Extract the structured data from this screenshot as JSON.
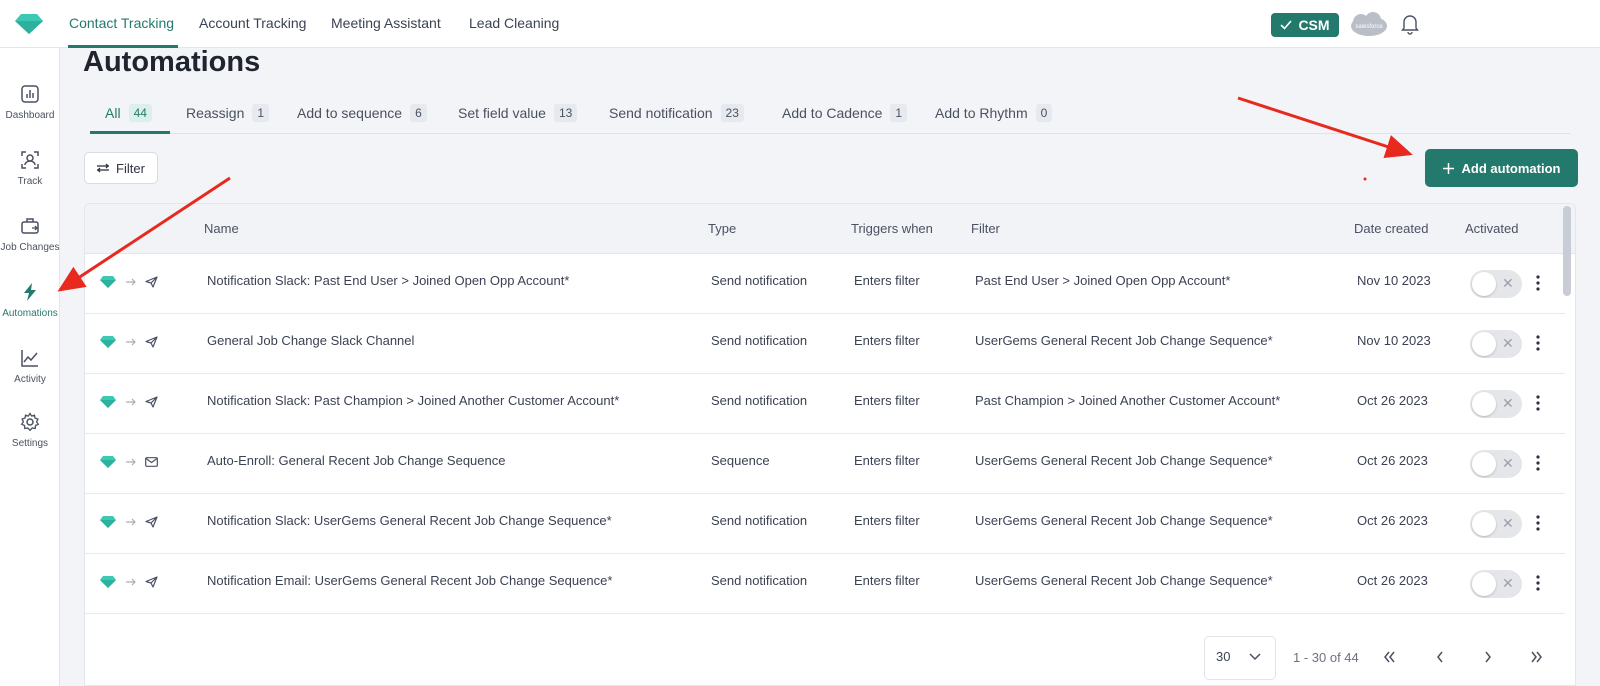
{
  "topnav": {
    "items": [
      {
        "label": "Contact Tracking",
        "active": true
      },
      {
        "label": "Account Tracking",
        "active": false
      },
      {
        "label": "Meeting Assistant",
        "active": false
      },
      {
        "label": "Lead Cleaning",
        "active": false
      }
    ],
    "csm_label": "CSM",
    "salesforce_label": "salesforce"
  },
  "sidebar": {
    "items": [
      {
        "label": "Dashboard",
        "icon": "chart-icon",
        "active": false
      },
      {
        "label": "Track",
        "icon": "person-scan-icon",
        "active": false
      },
      {
        "label": "Job Changes",
        "icon": "briefcase-icon",
        "active": false
      },
      {
        "label": "Automations",
        "icon": "lightning-icon",
        "active": true
      },
      {
        "label": "Activity",
        "icon": "trend-icon",
        "active": false
      },
      {
        "label": "Settings",
        "icon": "gear-icon",
        "active": false
      }
    ]
  },
  "page": {
    "title": "Automations",
    "filter_label": "Filter",
    "add_label": "Add automation"
  },
  "tabs": [
    {
      "label": "All",
      "count": "44",
      "active": true
    },
    {
      "label": "Reassign",
      "count": "1"
    },
    {
      "label": "Add to sequence",
      "count": "6"
    },
    {
      "label": "Set field value",
      "count": "13"
    },
    {
      "label": "Send notification",
      "count": "23"
    },
    {
      "label": "Add to Cadence",
      "count": "1"
    },
    {
      "label": "Add to Rhythm",
      "count": "0"
    }
  ],
  "table": {
    "headers": {
      "name": "Name",
      "type": "Type",
      "triggers": "Triggers when",
      "filter": "Filter",
      "date": "Date created",
      "activated": "Activated"
    },
    "rows": [
      {
        "action_icon": "send-icon",
        "name": "Notification Slack: Past End User > Joined Open Opp Account*",
        "type": "Send notification",
        "trigger": "Enters filter",
        "filter": "Past End User > Joined Open Opp Account*",
        "date": "Nov 10 2023",
        "activated": false
      },
      {
        "action_icon": "send-icon",
        "name": "General Job Change Slack Channel",
        "type": "Send notification",
        "trigger": "Enters filter",
        "filter": "UserGems General Recent Job Change Sequence*",
        "date": "Nov 10 2023",
        "activated": false
      },
      {
        "action_icon": "send-icon",
        "name": "Notification Slack: Past Champion > Joined Another Customer Account*",
        "type": "Send notification",
        "trigger": "Enters filter",
        "filter": "Past Champion > Joined Another Customer Account*",
        "date": "Oct 26 2023",
        "activated": false
      },
      {
        "action_icon": "mail-icon",
        "name": "Auto-Enroll: General Recent Job Change Sequence",
        "type": "Sequence",
        "trigger": "Enters filter",
        "filter": "UserGems General Recent Job Change Sequence*",
        "date": "Oct 26 2023",
        "activated": false
      },
      {
        "action_icon": "send-icon",
        "name": "Notification Slack: UserGems General Recent Job Change Sequence*",
        "type": "Send notification",
        "trigger": "Enters filter",
        "filter": "UserGems General Recent Job Change Sequence*",
        "date": "Oct 26 2023",
        "activated": false
      },
      {
        "action_icon": "send-icon",
        "name": "Notification Email: UserGems General Recent Job Change Sequence*",
        "type": "Send notification",
        "trigger": "Enters filter",
        "filter": "UserGems General Recent Job Change Sequence*",
        "date": "Oct 26 2023",
        "activated": false
      }
    ]
  },
  "pagination": {
    "page_size": "30",
    "range": "1 - 30 of 44"
  },
  "colors": {
    "accent": "#237a6c",
    "gem": "#3cc9b4",
    "annotation_arrow": "#e8291e"
  }
}
